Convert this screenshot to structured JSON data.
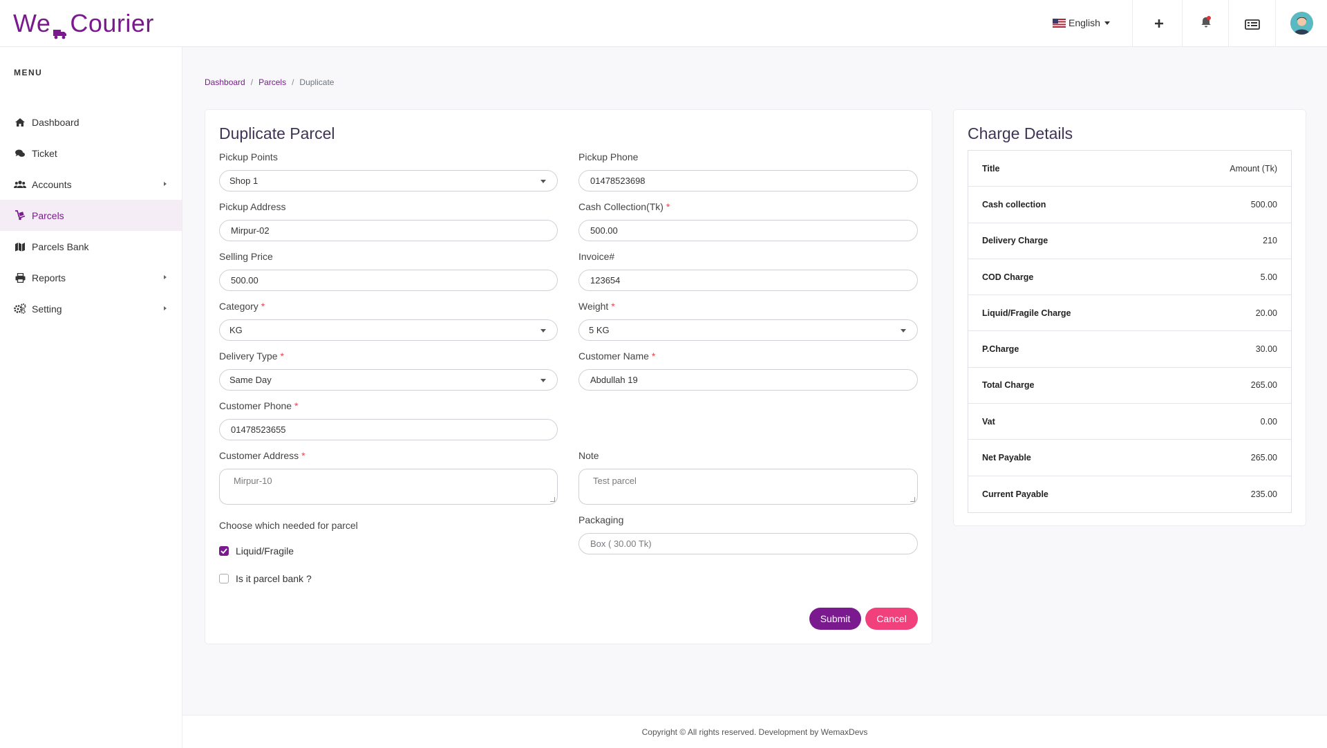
{
  "app": {
    "logo_text_left": "We",
    "logo_text_right": "Courier",
    "brand_color": "#7a1a8e"
  },
  "header": {
    "language": "English",
    "icons": [
      "plus-icon",
      "bell-icon",
      "list-icon",
      "avatar"
    ]
  },
  "sidebar": {
    "menu_title": "MENU",
    "items": [
      {
        "label": "Dashboard",
        "icon": "home-icon"
      },
      {
        "label": "Ticket",
        "icon": "comments-icon"
      },
      {
        "label": "Accounts",
        "icon": "users-icon"
      },
      {
        "label": "Parcels",
        "icon": "dolly-icon"
      },
      {
        "label": "Parcels Bank",
        "icon": "map-icon"
      },
      {
        "label": "Reports",
        "icon": "print-icon"
      },
      {
        "label": "Setting",
        "icon": "cogs-icon"
      }
    ]
  },
  "breadcrumb": {
    "items": [
      "Dashboard",
      "Parcels"
    ],
    "current": "Duplicate",
    "separator": "/"
  },
  "form": {
    "title": "Duplicate Parcel",
    "pickup_points": {
      "label": "Pickup Points",
      "value": "Shop 1"
    },
    "pickup_phone": {
      "label": "Pickup Phone",
      "value": "01478523698"
    },
    "pickup_address": {
      "label": "Pickup Address",
      "value": "Mirpur-02"
    },
    "cash_collection": {
      "label": "Cash Collection(Tk)",
      "value": "500.00"
    },
    "selling_price": {
      "label": "Selling Price",
      "value": "500.00"
    },
    "invoice": {
      "label": "Invoice#",
      "value": "123654"
    },
    "category": {
      "label": "Category",
      "value": "KG"
    },
    "weight": {
      "label": "Weight",
      "value": "5 KG"
    },
    "delivery_type": {
      "label": "Delivery Type",
      "value": "Same Day"
    },
    "customer_name": {
      "label": "Customer Name",
      "value": "Abdullah 19"
    },
    "customer_phone": {
      "label": "Customer Phone",
      "value": "01478523655"
    },
    "customer_address": {
      "label": "Customer Address",
      "placeholder": "Mirpur-10"
    },
    "note": {
      "label": "Note",
      "placeholder": "Test parcel"
    },
    "choose_label": "Choose which needed for parcel",
    "liquid_fragile": {
      "label": "Liquid/Fragile",
      "checked": true
    },
    "parcel_bank": {
      "label": "Is it parcel bank ?",
      "checked": false
    },
    "packaging": {
      "label": "Packaging",
      "placeholder": "Box ( 30.00 Tk)"
    },
    "required_mark": "*",
    "submit_label": "Submit",
    "cancel_label": "Cancel",
    "submit_color": "#7a1a8e",
    "cancel_color": "#f0417c"
  },
  "charge_details": {
    "title": "Charge Details",
    "header": {
      "title": "Title",
      "amount": "Amount (Tk)"
    },
    "rows": [
      {
        "title": "Cash collection",
        "amount": "500.00"
      },
      {
        "title": "Delivery Charge",
        "amount": "210"
      },
      {
        "title": "COD Charge",
        "amount": "5.00"
      },
      {
        "title": "Liquid/Fragile Charge",
        "amount": "20.00"
      },
      {
        "title": "P.Charge",
        "amount": "30.00"
      },
      {
        "title": "Total Charge",
        "amount": "265.00"
      },
      {
        "title": "Vat",
        "amount": "0.00"
      },
      {
        "title": "Net Payable",
        "amount": "265.00"
      },
      {
        "title": "Current Payable",
        "amount": "235.00"
      }
    ]
  },
  "footer": {
    "text": "Copyright © All rights reserved. Development by WemaxDevs"
  }
}
